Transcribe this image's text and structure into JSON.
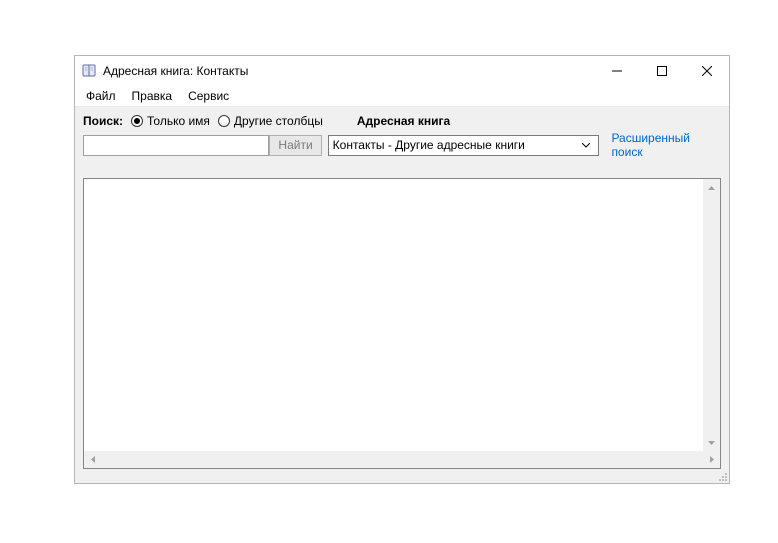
{
  "window": {
    "title": "Адресная книга: Контакты"
  },
  "menu": {
    "file": "Файл",
    "edit": "Правка",
    "service": "Сервис"
  },
  "search": {
    "label": "Поиск:",
    "radio_name_only": "Только имя",
    "radio_other_cols": "Другие столбцы",
    "book_label": "Адресная книга",
    "input_value": "",
    "find_button": "Найти",
    "combo_selected": "Контакты - Другие адресные книги",
    "advanced_link": "Расширенный поиск"
  }
}
